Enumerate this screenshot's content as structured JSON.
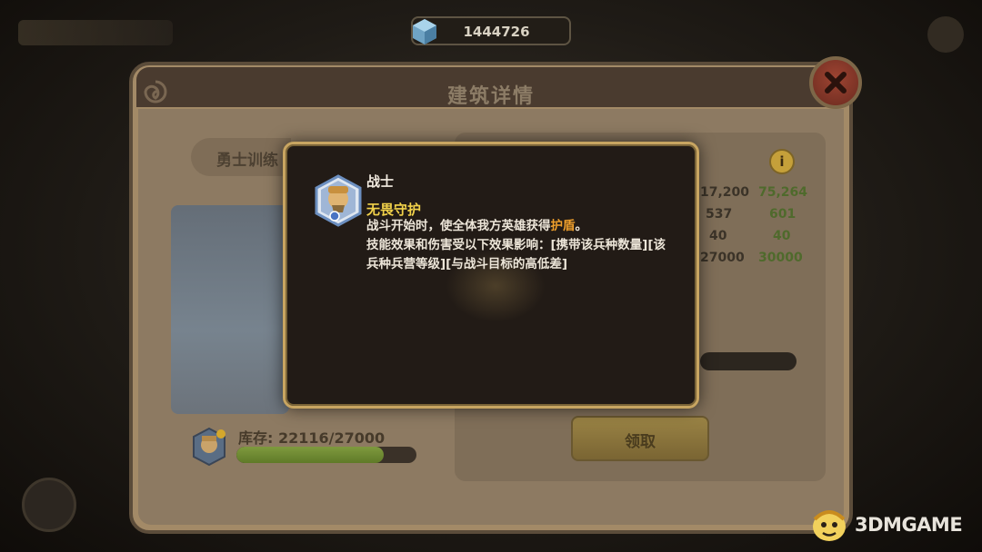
{
  "top_bar": {
    "currency": "1444726",
    "currency_icon": "gem-cube-icon"
  },
  "dialog": {
    "title": "建筑详情",
    "close_icon": "close-icon",
    "tab_label": "勇士训练",
    "right_stats": [
      {
        "a": "17,200",
        "b": "75,264"
      },
      {
        "a": "537",
        "b": "601"
      },
      {
        "a": "40",
        "b": "40"
      },
      {
        "a": "27000",
        "b": "30000"
      }
    ],
    "info_label": "i",
    "claim_button": "领取",
    "stock": {
      "label": "库存: 22116/27000",
      "current": 22116,
      "max": 27000
    }
  },
  "tooltip": {
    "unit_name": "战士",
    "skill_name": "无畏守护",
    "desc_line1_prefix": "战斗开始时，使全体我方英雄获得",
    "desc_line1_keyword": "护盾",
    "desc_line1_suffix": "。",
    "desc_line2": "技能效果和伤害受以下效果影响：[携带该兵种数量][该兵种兵营等级][与战斗目标的高低差]"
  },
  "watermark": {
    "text": "3DMGAME"
  },
  "colors": {
    "tooltip_border": "#c8a561",
    "skill_name": "#f2d24a",
    "keyword": "#f0a02c",
    "stock_fill": "#6f8a33"
  }
}
